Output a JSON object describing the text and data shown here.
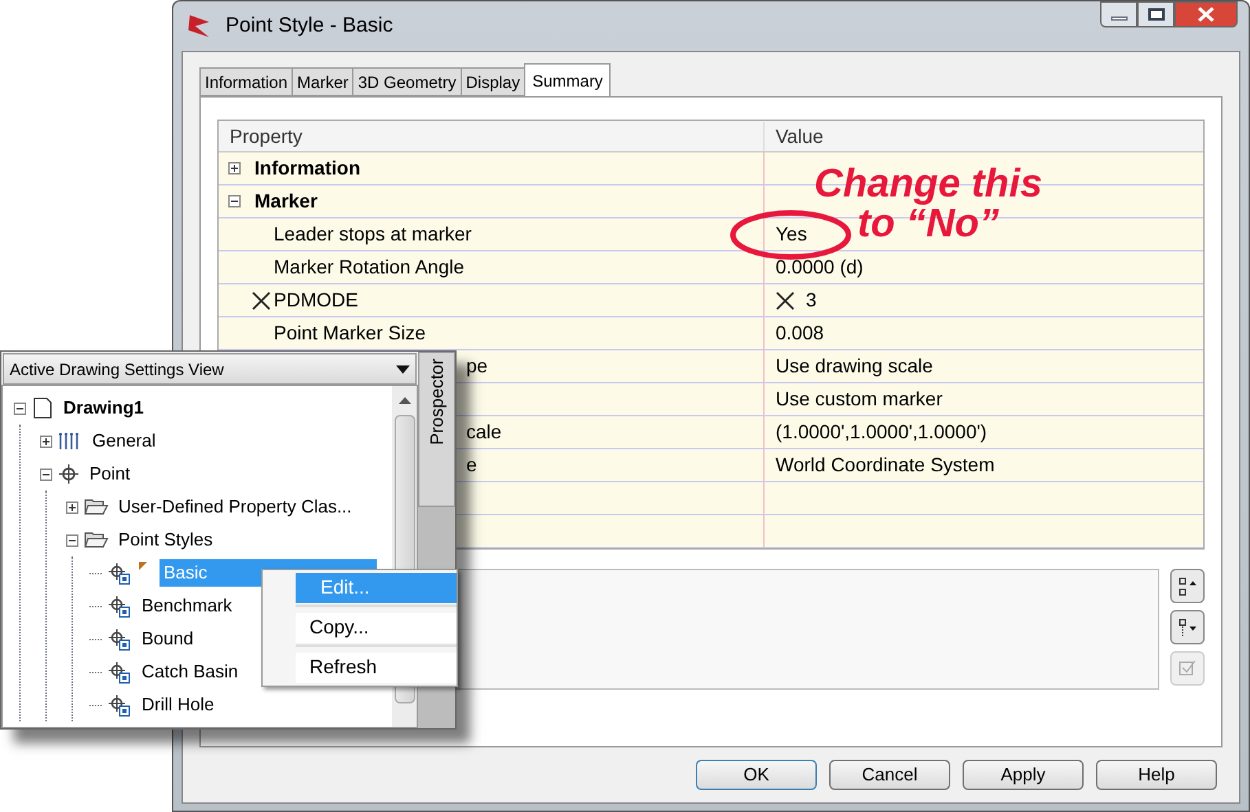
{
  "window": {
    "title": "Point Style - Basic"
  },
  "tabs": [
    {
      "label": "Information",
      "selected": false
    },
    {
      "label": "Marker",
      "selected": false
    },
    {
      "label": "3D Geometry",
      "selected": false
    },
    {
      "label": "Display",
      "selected": false
    },
    {
      "label": "Summary",
      "selected": true
    }
  ],
  "grid": {
    "columns": [
      "Property",
      "Value"
    ],
    "rows": [
      {
        "kind": "category",
        "name": "Information",
        "expanded": false
      },
      {
        "kind": "category",
        "name": "Marker",
        "expanded": true
      },
      {
        "kind": "property",
        "name": "Leader stops at marker",
        "value": "Yes",
        "overridden": false
      },
      {
        "kind": "property",
        "name": "Marker Rotation Angle",
        "value": "0.0000 (d)",
        "overridden": false
      },
      {
        "kind": "property",
        "name": "PDMODE",
        "value": "3",
        "overridden": true
      },
      {
        "kind": "property",
        "name": "Point Marker Size",
        "value": "0.008",
        "overridden": false
      },
      {
        "kind": "partial",
        "name": "pe",
        "value": "Use drawing scale"
      },
      {
        "kind": "partial",
        "name": "",
        "value": "Use custom marker"
      },
      {
        "kind": "partial",
        "name": "cale",
        "value": "(1.0000',1.0000',1.0000')"
      },
      {
        "kind": "partial",
        "name": "e",
        "value": "World Coordinate System"
      },
      {
        "kind": "empty"
      },
      {
        "kind": "empty"
      }
    ]
  },
  "annotation": {
    "lines": [
      "Change this",
      "to “No”"
    ]
  },
  "buttons": [
    "OK",
    "Cancel",
    "Apply",
    "Help"
  ],
  "prospector": {
    "view": "Active Drawing Settings View",
    "tab": "Prospector",
    "tree": [
      {
        "label": "Drawing1",
        "kind": "document",
        "expanded": true,
        "children": [
          {
            "label": "General",
            "kind": "wrench",
            "expanded": false
          },
          {
            "label": "Point",
            "kind": "point",
            "expanded": true,
            "children": [
              {
                "label": "User-Defined Property Clas...",
                "kind": "folder",
                "expanded": false
              },
              {
                "label": "Point Styles",
                "kind": "folder",
                "expanded": true,
                "children": [
                  {
                    "label": "Basic",
                    "kind": "style",
                    "selected": true
                  },
                  {
                    "label": "Benchmark",
                    "kind": "style",
                    "selected": false
                  },
                  {
                    "label": "Bound",
                    "kind": "style",
                    "selected": false
                  },
                  {
                    "label": "Catch Basin",
                    "kind": "style",
                    "selected": false
                  },
                  {
                    "label": "Drill Hole",
                    "kind": "style",
                    "selected": false
                  }
                ]
              }
            ]
          }
        ]
      }
    ]
  },
  "context_menu": [
    {
      "label": "Edit...",
      "selected": true
    },
    {
      "label": "Copy...",
      "selected": false
    },
    {
      "label": "Refresh",
      "selected": false
    }
  ]
}
